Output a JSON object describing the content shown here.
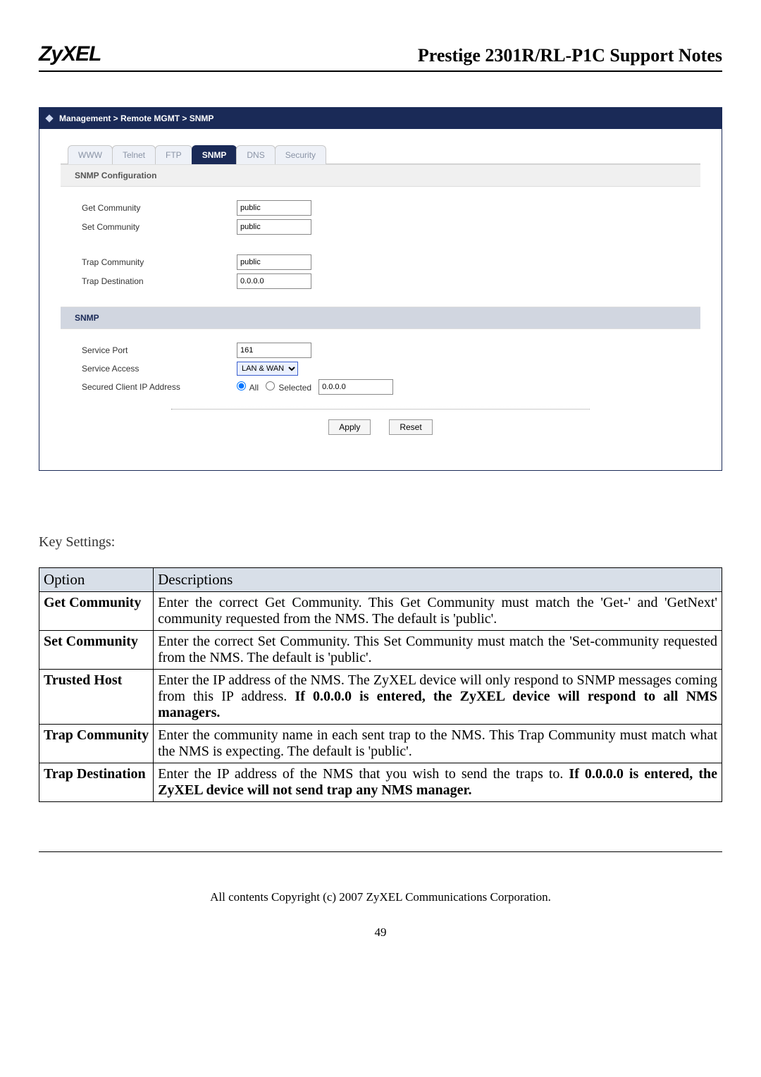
{
  "header": {
    "logo": "ZyXEL",
    "title": "Prestige 2301R/RL-P1C Support Notes"
  },
  "ui": {
    "breadcrumb": "Management > Remote MGMT > SNMP",
    "tabs": [
      "WWW",
      "Telnet",
      "FTP",
      "SNMP",
      "DNS",
      "Security"
    ],
    "active_tab": "SNMP",
    "section1_title": "SNMP Configuration",
    "get_community_label": "Get Community",
    "get_community_value": "public",
    "set_community_label": "Set Community",
    "set_community_value": "public",
    "trap_community_label": "Trap  Community",
    "trap_community_value": "public",
    "trap_destination_label": "Trap  Destination",
    "trap_destination_value": "0.0.0.0",
    "section2_title": "SNMP",
    "service_port_label": "Service Port",
    "service_port_value": "161",
    "service_access_label": "Service Access",
    "service_access_value": "LAN & WAN",
    "secured_ip_label": "Secured Client IP Address",
    "radio_all": "All",
    "radio_selected": "Selected",
    "secured_ip_value": "0.0.0.0",
    "apply_label": "Apply",
    "reset_label": "Reset"
  },
  "doc": {
    "key_settings": "Key Settings:",
    "table_headers": [
      "Option",
      "Descriptions"
    ],
    "rows": [
      {
        "option": "Get Community",
        "desc": "Enter the correct Get Community. This Get Community must match the 'Get-' and 'GetNext' community requested from the NMS. The default is 'public'."
      },
      {
        "option": "Set Community",
        "desc": "Enter the correct Set Community. This Set Community must match the 'Set-community requested from the NMS. The default is 'public'."
      },
      {
        "option": "Trusted Host",
        "desc_plain": "Enter the IP address of the NMS. The ZyXEL device will only respond to SNMP messages coming from this IP address. ",
        "desc_bold": "If 0.0.0.0 is entered, the ZyXEL device will respond to all NMS managers."
      },
      {
        "option": "Trap Community",
        "desc": "Enter the community name in each sent trap to the NMS. This Trap Community must match what the NMS is expecting. The default is 'public'."
      },
      {
        "option": "Trap Destination",
        "desc_plain": "Enter the IP address of the NMS that you wish to send the traps to. ",
        "desc_bold": "If 0.0.0.0 is entered, the ZyXEL device will not send trap any NMS manager."
      }
    ],
    "copyright": "All contents Copyright (c) 2007 ZyXEL Communications Corporation.",
    "page_number": "49"
  }
}
